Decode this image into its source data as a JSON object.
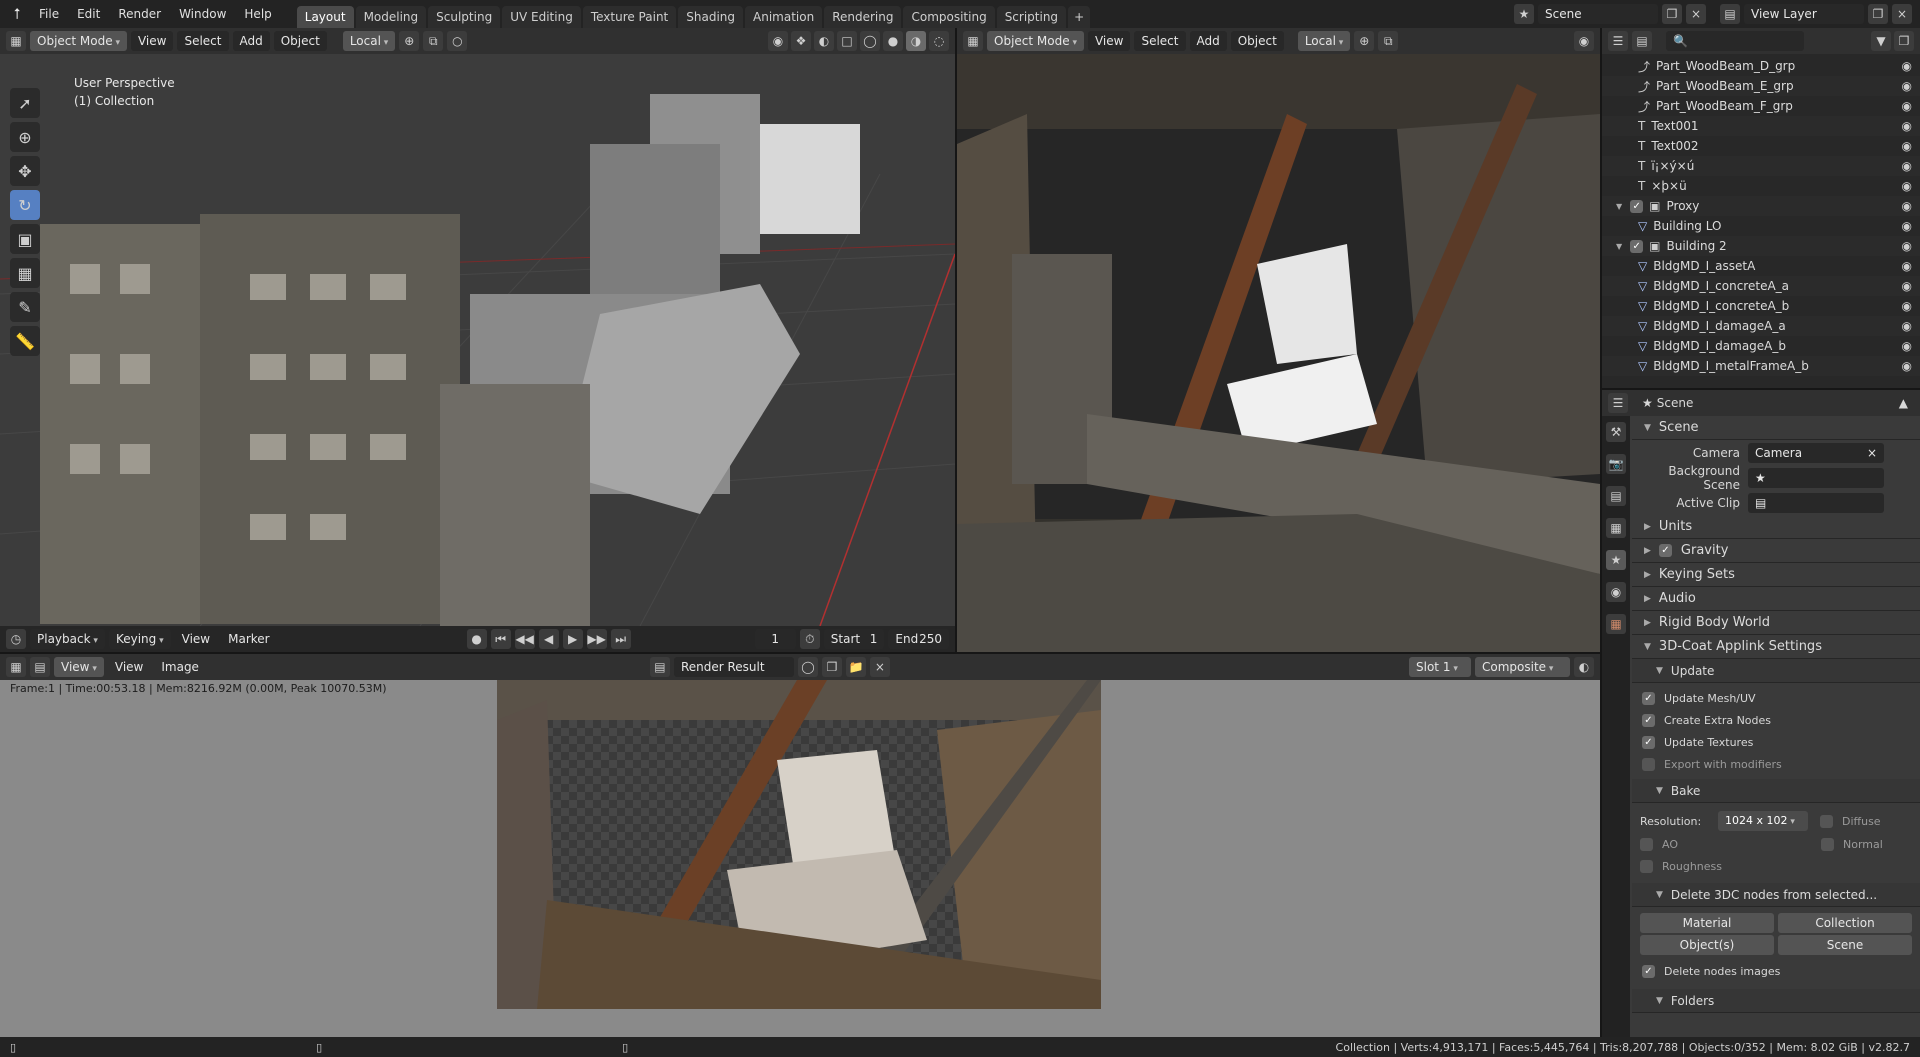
{
  "topbar": {
    "menu": [
      "File",
      "Edit",
      "Render",
      "Window",
      "Help"
    ],
    "tabs": [
      "Layout",
      "Modeling",
      "Sculpting",
      "UV Editing",
      "Texture Paint",
      "Shading",
      "Animation",
      "Rendering",
      "Compositing",
      "Scripting"
    ],
    "active_tab": "Layout",
    "scene_name": "Scene",
    "view_layer": "View Layer"
  },
  "viewport_left": {
    "mode": "Object Mode",
    "menu": [
      "View",
      "Select",
      "Add",
      "Object"
    ],
    "orientation": "Local",
    "overlay_line1": "User Perspective",
    "overlay_line2": "(1) Collection"
  },
  "viewport_right": {
    "mode": "Object Mode",
    "menu": [
      "View",
      "Select",
      "Add",
      "Object"
    ],
    "orientation": "Local"
  },
  "timeline": {
    "menus": [
      "Playback",
      "Keying",
      "View",
      "Marker"
    ],
    "current_frame": "1",
    "start_label": "Start",
    "start_value": "1",
    "end_label": "End",
    "end_value": "250"
  },
  "image_editor": {
    "view_menu": "View",
    "menus": [
      "View",
      "Image"
    ],
    "image_name": "Render Result",
    "slot": "Slot 1",
    "pass": "Composite",
    "info": "Frame:1 | Time:00:53.18 | Mem:8216.92M (0.00M, Peak 10070.53M)"
  },
  "outliner": {
    "items": [
      {
        "label": "Part_WoodBeam_D_grp",
        "indent": 2,
        "icon": "empty"
      },
      {
        "label": "Part_WoodBeam_E_grp",
        "indent": 2,
        "icon": "empty"
      },
      {
        "label": "Part_WoodBeam_F_grp",
        "indent": 2,
        "icon": "empty"
      },
      {
        "label": "Text001",
        "indent": 2,
        "icon": "text"
      },
      {
        "label": "Text002",
        "indent": 2,
        "icon": "text"
      },
      {
        "label": "ï¡×ý×ú",
        "indent": 2,
        "icon": "text"
      },
      {
        "label": "×þ×ü",
        "indent": 2,
        "icon": "text"
      },
      {
        "label": "Proxy",
        "indent": 1,
        "icon": "collection"
      },
      {
        "label": "Building LO",
        "indent": 2,
        "icon": "mesh"
      },
      {
        "label": "Building 2",
        "indent": 1,
        "icon": "collection"
      },
      {
        "label": "BldgMD_I_assetA",
        "indent": 2,
        "icon": "mesh"
      },
      {
        "label": "BldgMD_I_concreteA_a",
        "indent": 2,
        "icon": "mesh"
      },
      {
        "label": "BldgMD_I_concreteA_b",
        "indent": 2,
        "icon": "mesh"
      },
      {
        "label": "BldgMD_I_damageA_a",
        "indent": 2,
        "icon": "mesh"
      },
      {
        "label": "BldgMD_I_damageA_b",
        "indent": 2,
        "icon": "mesh"
      },
      {
        "label": "BldgMD_I_metalFrameA_b",
        "indent": 2,
        "icon": "mesh"
      }
    ]
  },
  "properties": {
    "context": "Scene",
    "scene_panel": "Scene",
    "camera_label": "Camera",
    "camera_value": "Camera",
    "background_label": "Background Scene",
    "clip_label": "Active Clip",
    "panels": [
      "Units",
      "Gravity",
      "Keying Sets",
      "Audio",
      "Rigid Body World"
    ],
    "applink_panel": "3D-Coat Applink Settings",
    "update_sub": "Update",
    "update_options": [
      {
        "label": "Update Mesh/UV",
        "checked": true
      },
      {
        "label": "Create Extra Nodes",
        "checked": true
      },
      {
        "label": "Update Textures",
        "checked": true
      },
      {
        "label": "Export with modifiers",
        "checked": false
      }
    ],
    "bake_sub": "Bake",
    "resolution_label": "Resolution:",
    "resolution_value": "1024 x 102",
    "bake_diffuse": "Diffuse",
    "bake_ao": "AO",
    "bake_normal": "Normal",
    "bake_roughness": "Roughness",
    "delete_sub": "Delete 3DC nodes from selected...",
    "btn_material": "Material",
    "btn_collection": "Collection",
    "btn_objects": "Object(s)",
    "btn_scene": "Scene",
    "delete_images": "Delete nodes images",
    "folders_sub": "Folders"
  },
  "statusbar": {
    "stats": "Collection | Verts:4,913,171 | Faces:5,445,764 | Tris:8,207,788 | Objects:0/352 | Mem: 8.02 GiB | v2.82.7"
  }
}
